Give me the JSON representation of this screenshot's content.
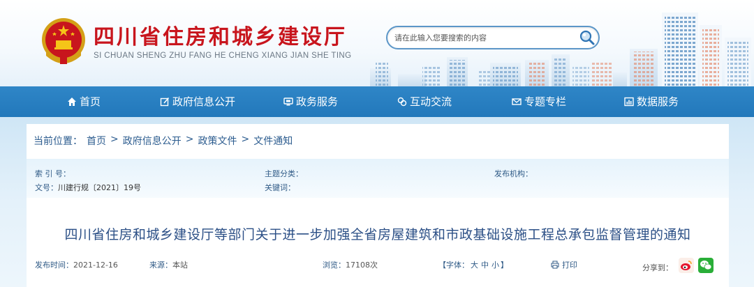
{
  "header": {
    "title": "四川省住房和城乡建设厅",
    "pinyin": "SI CHUAN SHENG ZHU FANG HE CHENG XIANG JIAN SHE TING",
    "search_placeholder": "请在此输入您要搜索的内容"
  },
  "nav": {
    "items": [
      {
        "label": "首页",
        "icon": "home-icon"
      },
      {
        "label": "政府信息公开",
        "icon": "edit-icon"
      },
      {
        "label": "政务服务",
        "icon": "monitor-icon"
      },
      {
        "label": "互动交流",
        "icon": "interaction-icon"
      },
      {
        "label": "专题专栏",
        "icon": "mail-icon"
      },
      {
        "label": "数据服务",
        "icon": "data-icon"
      }
    ]
  },
  "breadcrumb": {
    "label": "当前位置：",
    "items": [
      "首页",
      "政府信息公开",
      "政策文件",
      "文件通知"
    ],
    "sep": ">"
  },
  "meta": {
    "index_label": "索 引 号：",
    "doc_no_label": "文号：",
    "doc_no_value": "川建行规〔2021〕19号",
    "topic_label": "主题分类：",
    "keyword_label": "关键词：",
    "publisher_label": "发布机构："
  },
  "document": {
    "title": "四川省住房和城乡建设厅等部门关于进一步加强全省房屋建筑和市政基础设施工程总承包监督管理的通知"
  },
  "info": {
    "date_label": "发布时间：",
    "date_value": "2021-12-16",
    "source_label": "来源：",
    "source_value": "本站",
    "views_label": "浏览：",
    "views_value": "17108次",
    "font_label": "【字体：",
    "font_large": "大",
    "font_medium": "中",
    "font_small": "小",
    "font_close": "】",
    "print_label": "打印",
    "share_label": "分享到："
  },
  "colors": {
    "title_red": "#c8151d",
    "nav_blue": "#2278bb",
    "doc_title_blue": "#2b4f86"
  }
}
